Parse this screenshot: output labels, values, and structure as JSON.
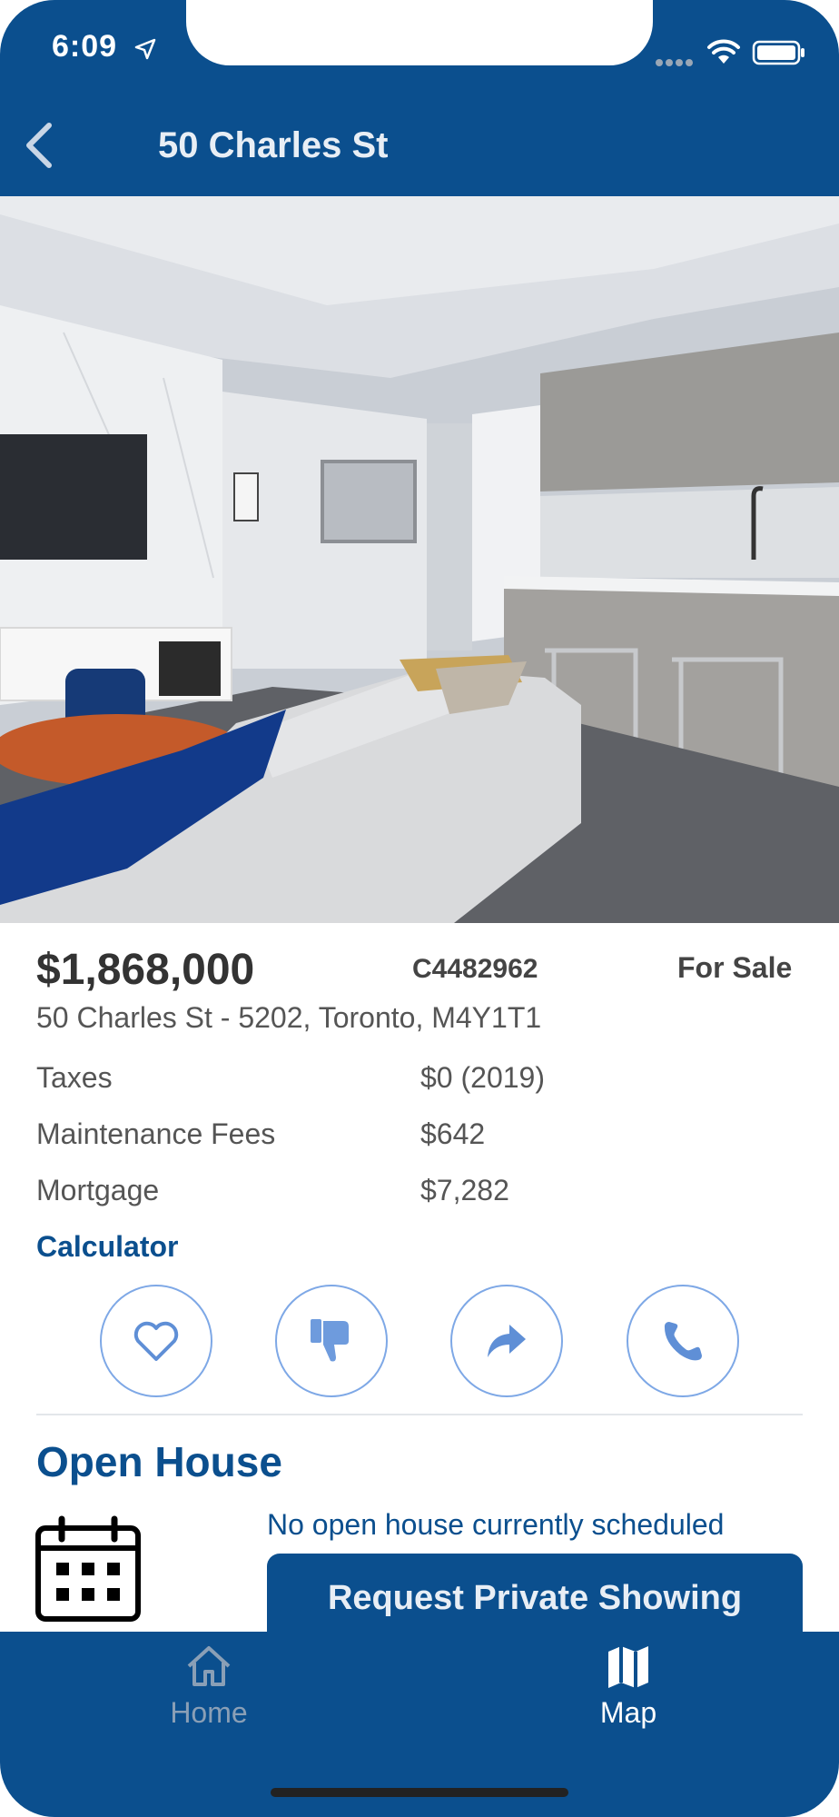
{
  "status_bar": {
    "time": "6:09"
  },
  "header": {
    "title": "50 Charles St"
  },
  "listing": {
    "price": "$1,868,000",
    "mls_number": "C4482962",
    "status": "For Sale",
    "address": "50 Charles St - 5202, Toronto, M4Y1T1",
    "details": [
      {
        "label": "Taxes",
        "value": "$0 (2019)"
      },
      {
        "label": "Maintenance Fees",
        "value": "$642"
      },
      {
        "label": "Mortgage",
        "value": "$7,282"
      }
    ],
    "calculator_link": "Calculator"
  },
  "actions": {
    "icons": [
      "heart-icon",
      "thumbs-down-icon",
      "share-icon",
      "phone-icon"
    ],
    "accent_color": "#7ea8e6"
  },
  "open_house": {
    "title": "Open House",
    "message": "No open house currently scheduled",
    "request_button": "Request Private Showing"
  },
  "tabbar": {
    "tabs": [
      {
        "label": "Home",
        "icon": "home-icon",
        "active": false
      },
      {
        "label": "Map",
        "icon": "map-icon",
        "active": true
      }
    ]
  },
  "colors": {
    "brand": "#0b4f8e",
    "tab_inactive": "#8a9fb6",
    "tab_active": "#ffffff"
  }
}
